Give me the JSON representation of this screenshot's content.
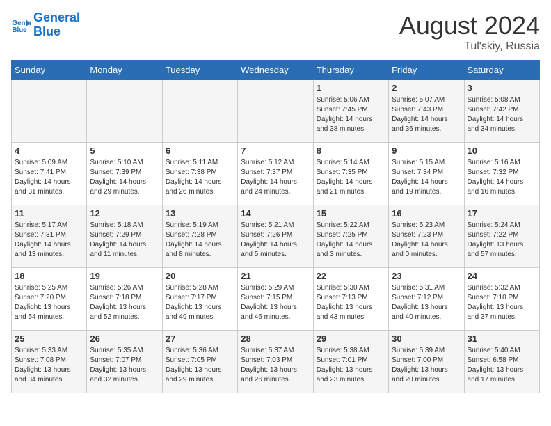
{
  "header": {
    "logo_line1": "General",
    "logo_line2": "Blue",
    "month_year": "August 2024",
    "location": "Tul'skiy, Russia"
  },
  "weekdays": [
    "Sunday",
    "Monday",
    "Tuesday",
    "Wednesday",
    "Thursday",
    "Friday",
    "Saturday"
  ],
  "weeks": [
    [
      {
        "day": "",
        "info": ""
      },
      {
        "day": "",
        "info": ""
      },
      {
        "day": "",
        "info": ""
      },
      {
        "day": "",
        "info": ""
      },
      {
        "day": "1",
        "info": "Sunrise: 5:06 AM\nSunset: 7:45 PM\nDaylight: 14 hours\nand 38 minutes."
      },
      {
        "day": "2",
        "info": "Sunrise: 5:07 AM\nSunset: 7:43 PM\nDaylight: 14 hours\nand 36 minutes."
      },
      {
        "day": "3",
        "info": "Sunrise: 5:08 AM\nSunset: 7:42 PM\nDaylight: 14 hours\nand 34 minutes."
      }
    ],
    [
      {
        "day": "4",
        "info": "Sunrise: 5:09 AM\nSunset: 7:41 PM\nDaylight: 14 hours\nand 31 minutes."
      },
      {
        "day": "5",
        "info": "Sunrise: 5:10 AM\nSunset: 7:39 PM\nDaylight: 14 hours\nand 29 minutes."
      },
      {
        "day": "6",
        "info": "Sunrise: 5:11 AM\nSunset: 7:38 PM\nDaylight: 14 hours\nand 26 minutes."
      },
      {
        "day": "7",
        "info": "Sunrise: 5:12 AM\nSunset: 7:37 PM\nDaylight: 14 hours\nand 24 minutes."
      },
      {
        "day": "8",
        "info": "Sunrise: 5:14 AM\nSunset: 7:35 PM\nDaylight: 14 hours\nand 21 minutes."
      },
      {
        "day": "9",
        "info": "Sunrise: 5:15 AM\nSunset: 7:34 PM\nDaylight: 14 hours\nand 19 minutes."
      },
      {
        "day": "10",
        "info": "Sunrise: 5:16 AM\nSunset: 7:32 PM\nDaylight: 14 hours\nand 16 minutes."
      }
    ],
    [
      {
        "day": "11",
        "info": "Sunrise: 5:17 AM\nSunset: 7:31 PM\nDaylight: 14 hours\nand 13 minutes."
      },
      {
        "day": "12",
        "info": "Sunrise: 5:18 AM\nSunset: 7:29 PM\nDaylight: 14 hours\nand 11 minutes."
      },
      {
        "day": "13",
        "info": "Sunrise: 5:19 AM\nSunset: 7:28 PM\nDaylight: 14 hours\nand 8 minutes."
      },
      {
        "day": "14",
        "info": "Sunrise: 5:21 AM\nSunset: 7:26 PM\nDaylight: 14 hours\nand 5 minutes."
      },
      {
        "day": "15",
        "info": "Sunrise: 5:22 AM\nSunset: 7:25 PM\nDaylight: 14 hours\nand 3 minutes."
      },
      {
        "day": "16",
        "info": "Sunrise: 5:23 AM\nSunset: 7:23 PM\nDaylight: 14 hours\nand 0 minutes."
      },
      {
        "day": "17",
        "info": "Sunrise: 5:24 AM\nSunset: 7:22 PM\nDaylight: 13 hours\nand 57 minutes."
      }
    ],
    [
      {
        "day": "18",
        "info": "Sunrise: 5:25 AM\nSunset: 7:20 PM\nDaylight: 13 hours\nand 54 minutes."
      },
      {
        "day": "19",
        "info": "Sunrise: 5:26 AM\nSunset: 7:18 PM\nDaylight: 13 hours\nand 52 minutes."
      },
      {
        "day": "20",
        "info": "Sunrise: 5:28 AM\nSunset: 7:17 PM\nDaylight: 13 hours\nand 49 minutes."
      },
      {
        "day": "21",
        "info": "Sunrise: 5:29 AM\nSunset: 7:15 PM\nDaylight: 13 hours\nand 46 minutes."
      },
      {
        "day": "22",
        "info": "Sunrise: 5:30 AM\nSunset: 7:13 PM\nDaylight: 13 hours\nand 43 minutes."
      },
      {
        "day": "23",
        "info": "Sunrise: 5:31 AM\nSunset: 7:12 PM\nDaylight: 13 hours\nand 40 minutes."
      },
      {
        "day": "24",
        "info": "Sunrise: 5:32 AM\nSunset: 7:10 PM\nDaylight: 13 hours\nand 37 minutes."
      }
    ],
    [
      {
        "day": "25",
        "info": "Sunrise: 5:33 AM\nSunset: 7:08 PM\nDaylight: 13 hours\nand 34 minutes."
      },
      {
        "day": "26",
        "info": "Sunrise: 5:35 AM\nSunset: 7:07 PM\nDaylight: 13 hours\nand 32 minutes."
      },
      {
        "day": "27",
        "info": "Sunrise: 5:36 AM\nSunset: 7:05 PM\nDaylight: 13 hours\nand 29 minutes."
      },
      {
        "day": "28",
        "info": "Sunrise: 5:37 AM\nSunset: 7:03 PM\nDaylight: 13 hours\nand 26 minutes."
      },
      {
        "day": "29",
        "info": "Sunrise: 5:38 AM\nSunset: 7:01 PM\nDaylight: 13 hours\nand 23 minutes."
      },
      {
        "day": "30",
        "info": "Sunrise: 5:39 AM\nSunset: 7:00 PM\nDaylight: 13 hours\nand 20 minutes."
      },
      {
        "day": "31",
        "info": "Sunrise: 5:40 AM\nSunset: 6:58 PM\nDaylight: 13 hours\nand 17 minutes."
      }
    ]
  ]
}
